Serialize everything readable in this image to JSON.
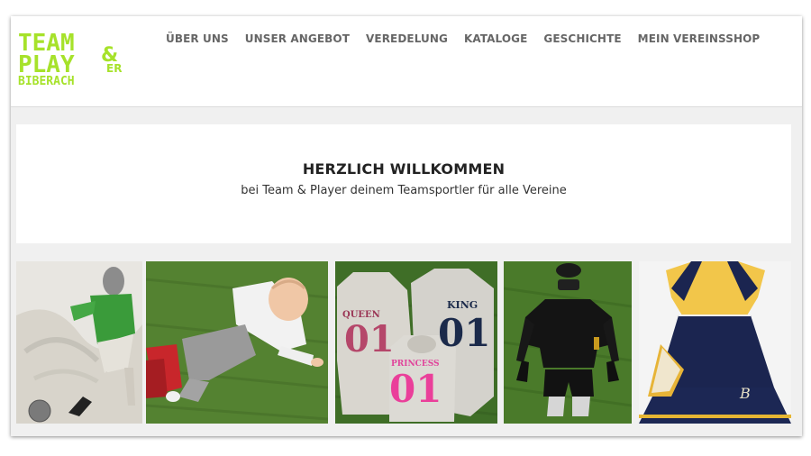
{
  "brand": {
    "logo_line1": "TEAM",
    "logo_amp": "&",
    "logo_line2": "PLAY",
    "logo_er": "ER",
    "logo_line3": "BIBERACH",
    "logo_color": "#a6e22a"
  },
  "nav": {
    "items": [
      {
        "label": "ÜBER UNS"
      },
      {
        "label": "UNSER ANGEBOT"
      },
      {
        "label": "VEREDELUNG"
      },
      {
        "label": "KATALOGE"
      },
      {
        "label": "GESCHICHTE"
      },
      {
        "label": "MEIN VEREINSSHOP"
      }
    ]
  },
  "welcome": {
    "title": "HERZLICH WILLKOMMEN",
    "subtitle": "bei Team & Player deinem Teamsportler für alle Vereine"
  },
  "gallery": {
    "hoodies": {
      "queen_label": "QUEEN",
      "queen_number": "01",
      "king_label": "KING",
      "king_number": "01",
      "princess_label": "PRINCESS",
      "princess_number": "01"
    },
    "cheer_logo": "B"
  }
}
